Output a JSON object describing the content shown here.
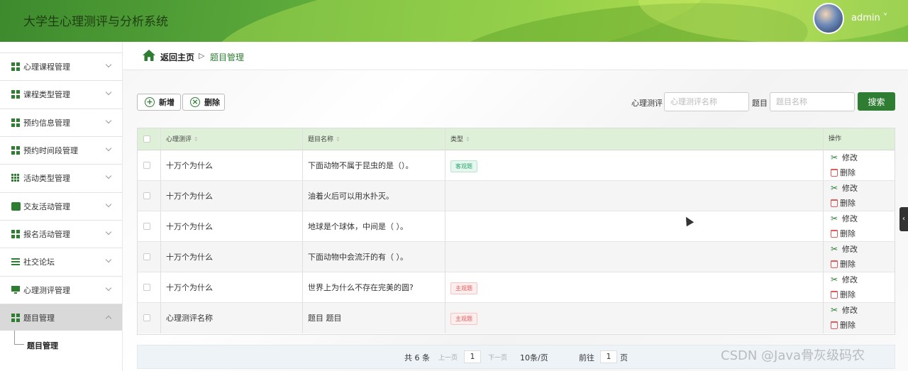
{
  "header": {
    "app_title": "大学生心理测评与分析系统",
    "user_name": "admin ˅"
  },
  "sidebar": {
    "items": [
      {
        "label": "心理课程管理",
        "icon": "grid-icon"
      },
      {
        "label": "课程类型管理",
        "icon": "grid-icon"
      },
      {
        "label": "预约信息管理",
        "icon": "grid-icon"
      },
      {
        "label": "预约时间段管理",
        "icon": "grid-icon"
      },
      {
        "label": "活动类型管理",
        "icon": "grid9-icon"
      },
      {
        "label": "交友活动管理",
        "icon": "wallet-icon"
      },
      {
        "label": "报名活动管理",
        "icon": "grid-icon"
      },
      {
        "label": "社交论坛",
        "icon": "list-icon"
      },
      {
        "label": "心理测评管理",
        "icon": "monitor-icon"
      },
      {
        "label": "题目管理",
        "icon": "grid-icon"
      }
    ],
    "sub_item": "题目管理"
  },
  "breadcrumb": {
    "home": "返回主页",
    "separator": "▷",
    "current": "题目管理"
  },
  "toolbar": {
    "add_label": "新增",
    "delete_label": "删除"
  },
  "search": {
    "assessment_label": "心理测评",
    "assessment_placeholder": "心理测评名称",
    "question_label": "题目",
    "question_placeholder": "题目名称",
    "button": "搜索"
  },
  "table": {
    "headers": [
      "心理测评",
      "题目名称",
      "类型",
      "操作"
    ],
    "sort_glyph": "⇕",
    "rows": [
      {
        "assessment": "十万个为什么",
        "question": "下面动物不属于昆虫的是（）。",
        "type": "客观题"
      },
      {
        "assessment": "十万个为什么",
        "question": "油着火后可以用水扑灭。",
        "type": ""
      },
      {
        "assessment": "十万个为什么",
        "question": "地球是个球体，中间是（ ）。",
        "type": ""
      },
      {
        "assessment": "十万个为什么",
        "question": "下面动物中会流汗的有（ ）。",
        "type": ""
      },
      {
        "assessment": "十万个为什么",
        "question": "世界上为什么不存在完美的圆?",
        "type": "主观题"
      },
      {
        "assessment": "心理测评名称",
        "question": "题目 题目",
        "type": "主观题"
      }
    ],
    "edit_label": "修改",
    "delete_label": "删除"
  },
  "pagination": {
    "total": "共 6 条",
    "prev": "上一页",
    "page": "1",
    "next": "下一页",
    "page_size": "10条/页",
    "goto_label": "前往",
    "goto_page": "1",
    "page_suffix": "页"
  },
  "watermark": "CSDN @Java骨灰级码农",
  "colors": {
    "accent": "#2e7d32",
    "header_bg": "#7cc043",
    "table_header_bg": "#dff0d8"
  }
}
